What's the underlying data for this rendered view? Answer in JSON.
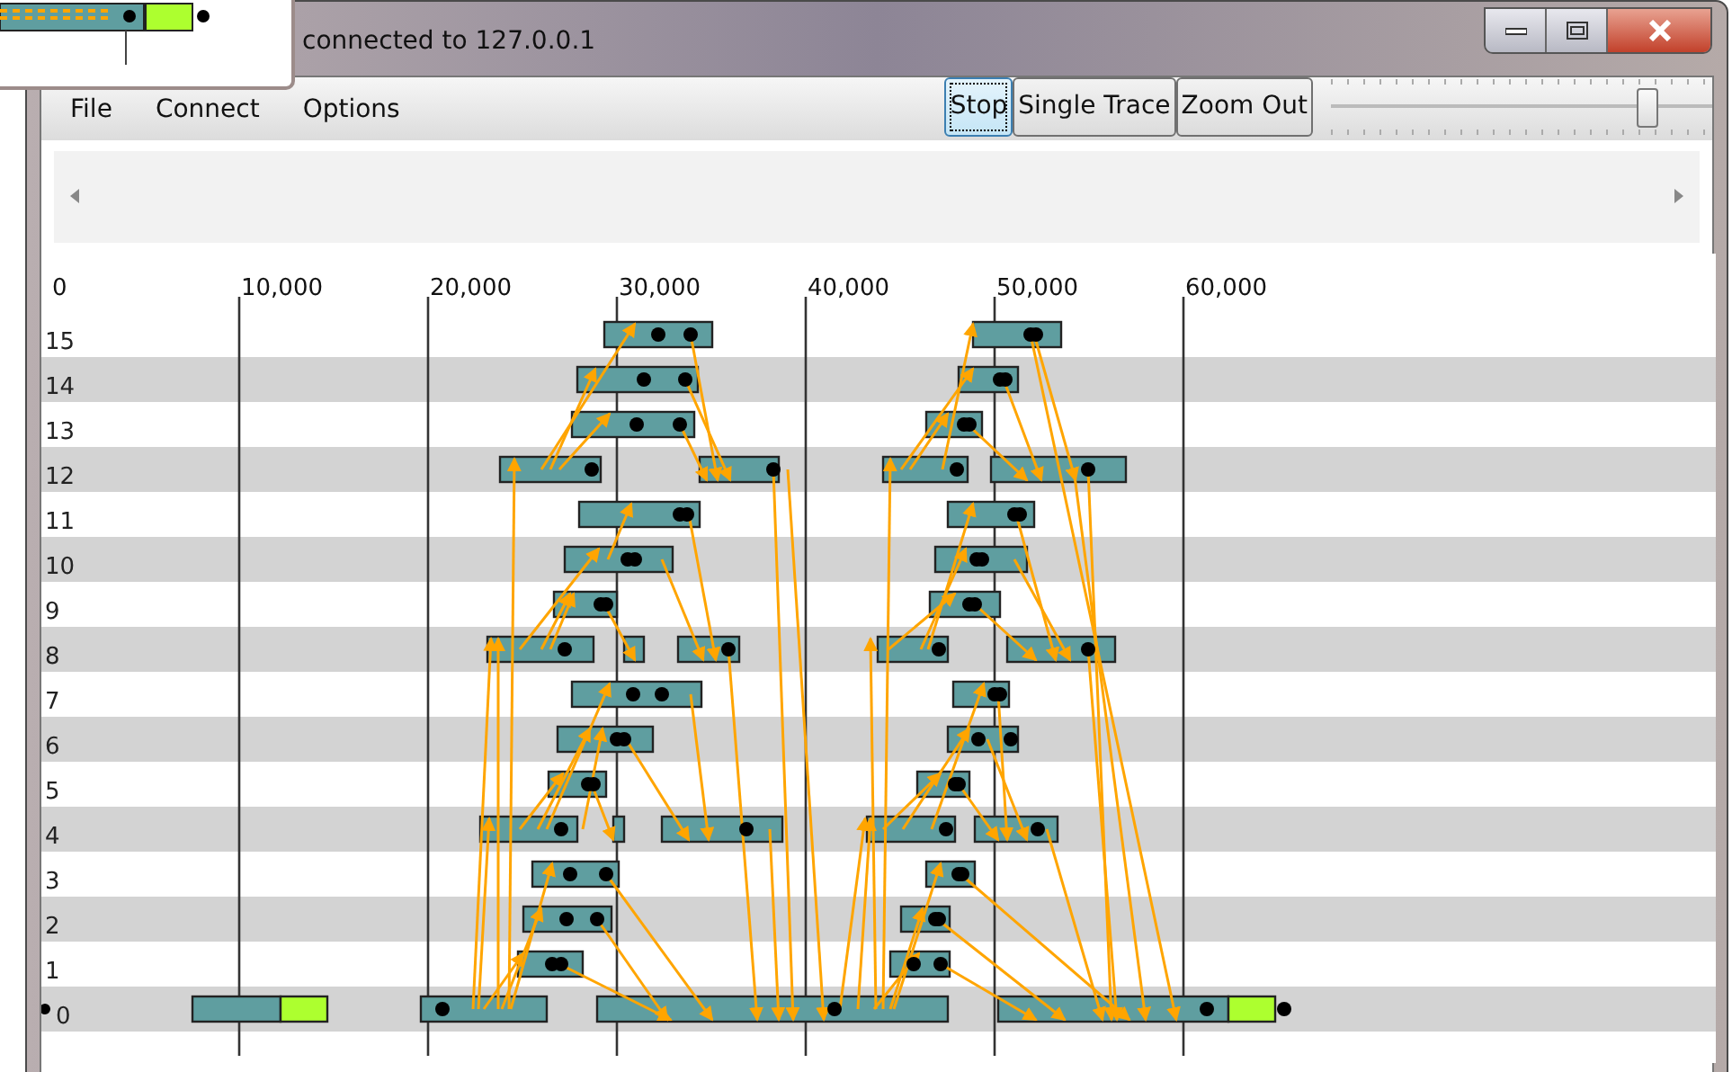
{
  "window": {
    "title": "connected to 127.0.0.1"
  },
  "menu": [
    {
      "label": "File"
    },
    {
      "label": "Connect"
    },
    {
      "label": "Options"
    }
  ],
  "toolbar": {
    "buttons": [
      {
        "label": "Stop",
        "focused": true
      },
      {
        "label": "Single Trace",
        "focused": false
      },
      {
        "label": "Zoom Out",
        "focused": false
      }
    ],
    "slider": {
      "level": 0.85
    }
  },
  "timeline": {
    "ticks": [
      "0",
      "10,000",
      "20,000",
      "30,000",
      "40,000",
      "50,000",
      "60,000"
    ],
    "rows": [
      {
        "label": "15",
        "shaded": false
      },
      {
        "label": "14",
        "shaded": true
      },
      {
        "label": "13",
        "shaded": false
      },
      {
        "label": "12",
        "shaded": true
      },
      {
        "label": "11",
        "shaded": false
      },
      {
        "label": "10",
        "shaded": true
      },
      {
        "label": "9",
        "shaded": false
      },
      {
        "label": "8",
        "shaded": true
      },
      {
        "label": "7",
        "shaded": false
      },
      {
        "label": "6",
        "shaded": true
      },
      {
        "label": "5",
        "shaded": false
      },
      {
        "label": "4",
        "shaded": true
      },
      {
        "label": "3",
        "shaded": false
      },
      {
        "label": "2",
        "shaded": true
      },
      {
        "label": "1",
        "shaded": false
      },
      {
        "label": "0",
        "shaded": true
      }
    ]
  }
}
